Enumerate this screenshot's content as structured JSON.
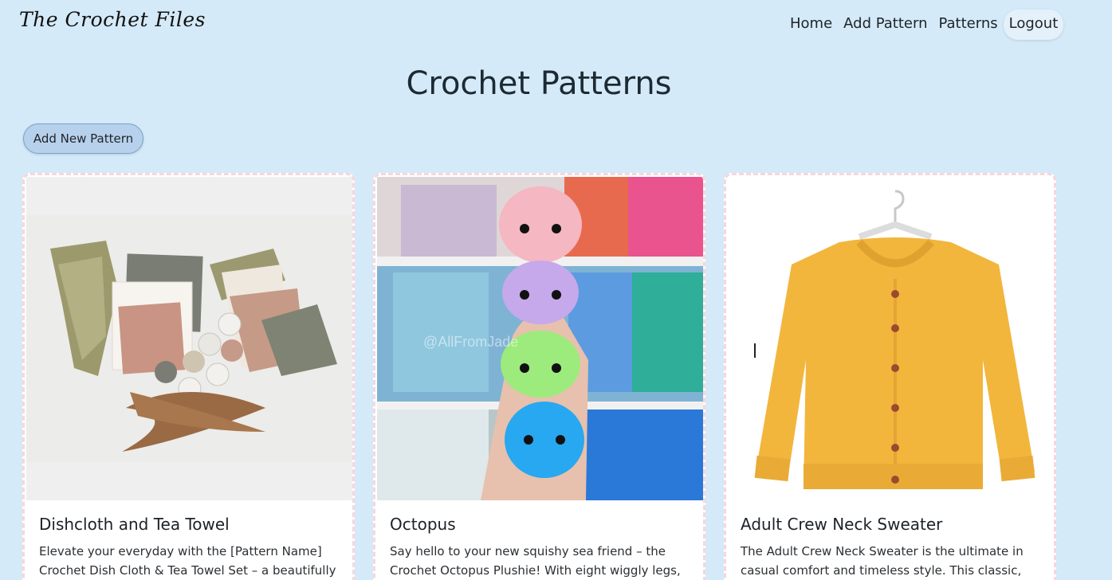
{
  "brand": "The Crochet Files",
  "nav": {
    "home": "Home",
    "add_pattern": "Add Pattern",
    "patterns": "Patterns",
    "logout": "Logout"
  },
  "page_title": "Crochet Patterns",
  "add_button": "Add New Pattern",
  "cards": [
    {
      "title": "Dishcloth and Tea Towel",
      "text": "Elevate your everyday with the [Pattern Name] Crochet Dish Cloth & Tea Towel Set – a beautifully"
    },
    {
      "title": "Octopus",
      "text": "Say hello to your new squishy sea friend – the Crochet Octopus Plushie! With eight wiggly legs, a",
      "watermark": "@AllFromJade"
    },
    {
      "title": "Adult Crew Neck Sweater",
      "text": "The Adult Crew Neck Sweater is the ultimate in casual comfort and timeless style. This classic,"
    }
  ],
  "colors": {
    "background": "#d4eaf8",
    "button": "#b7d1ec",
    "card_border": "#f7d6dc"
  }
}
